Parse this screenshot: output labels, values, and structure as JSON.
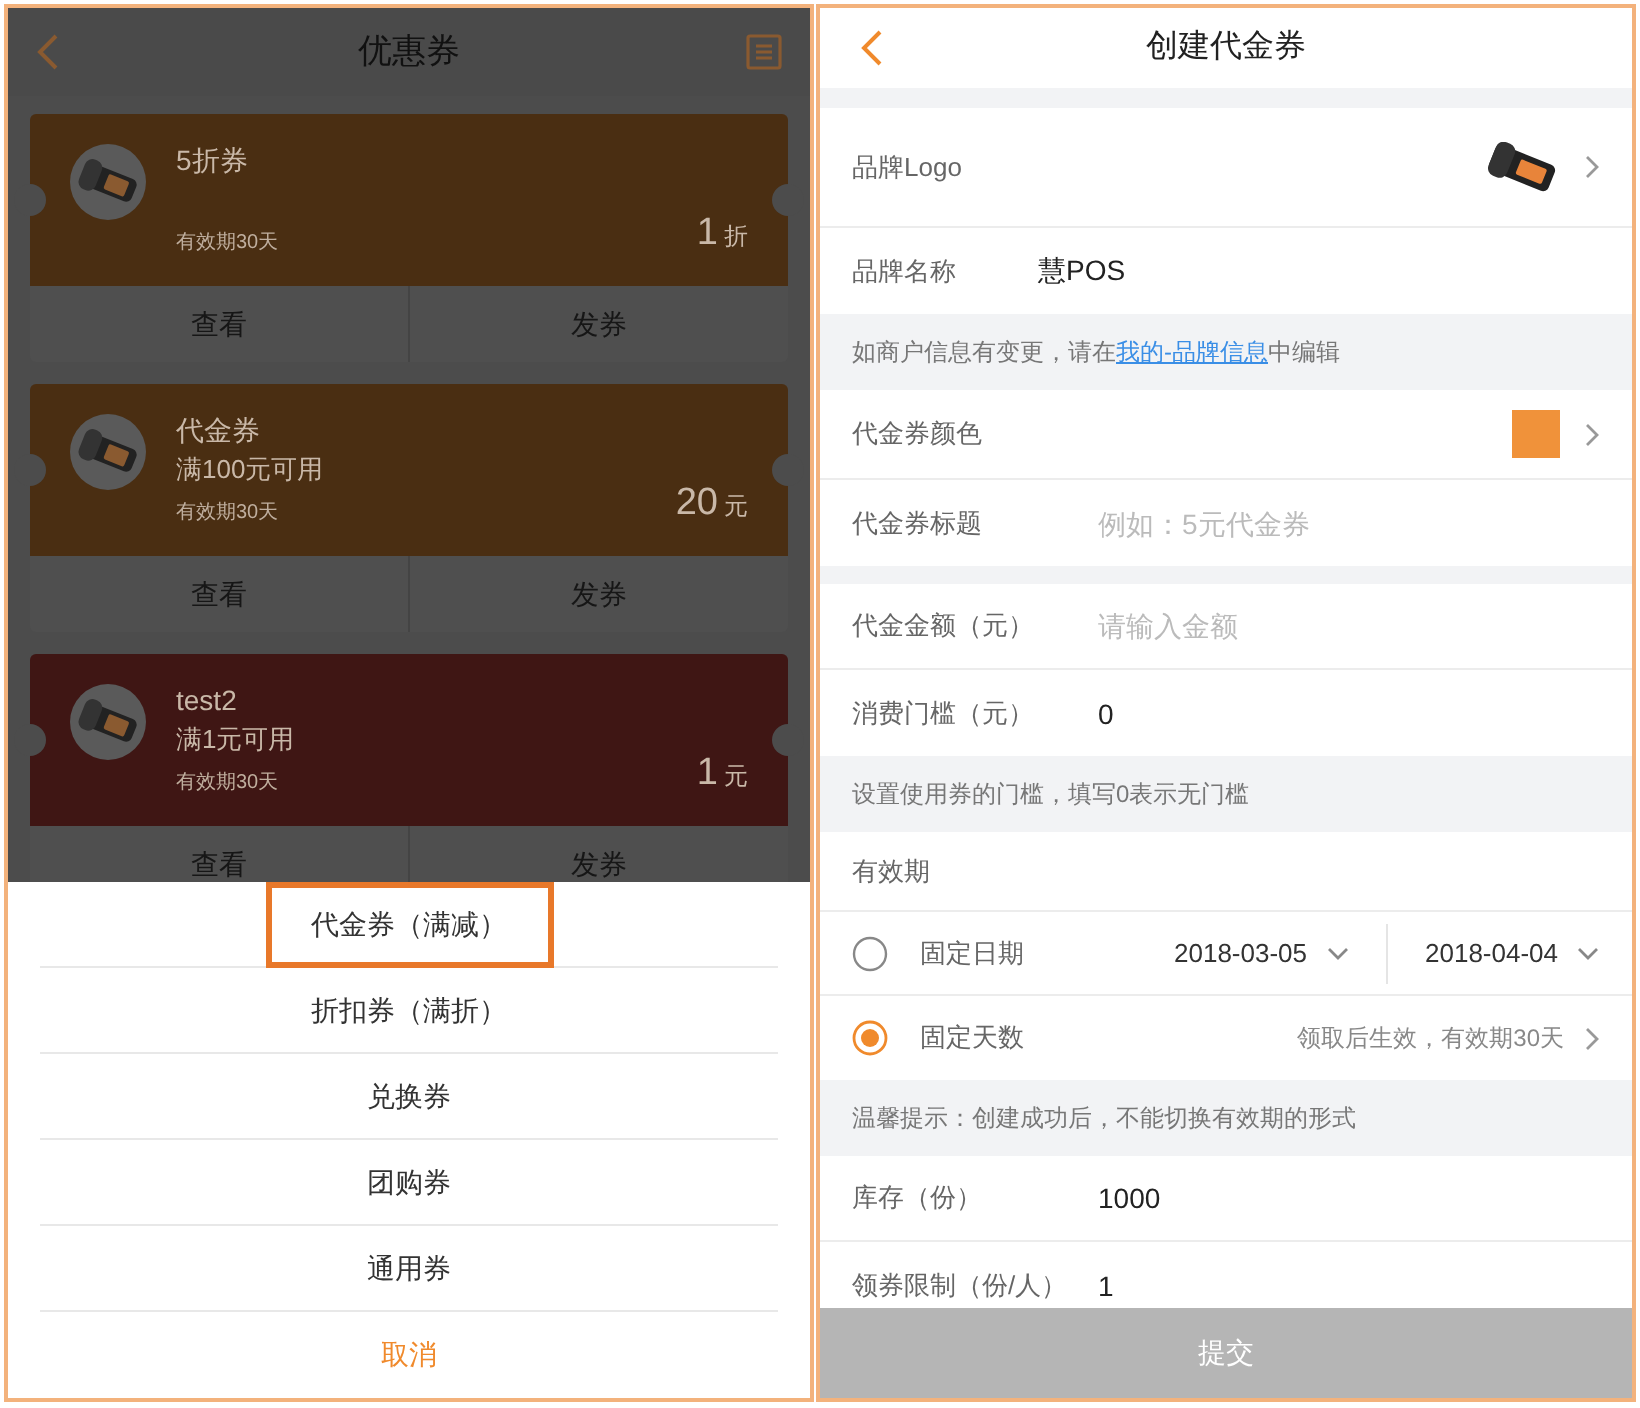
{
  "coupon_list": {
    "title": "优惠券",
    "coupons": [
      {
        "name": "5折券",
        "validity": "有效期30天",
        "amount": "1",
        "unit": "折",
        "color": "#4a2e12",
        "actions": [
          "查看",
          "发券"
        ]
      },
      {
        "name": "代金券",
        "condition": "满100元可用",
        "validity": "有效期30天",
        "amount": "20",
        "unit": "元",
        "color": "#4a2e12",
        "actions": [
          "查看",
          "发券"
        ]
      },
      {
        "name": "test2",
        "condition": "满1元可用",
        "validity": "有效期30天",
        "amount": "1",
        "unit": "元",
        "color": "#3f1614",
        "actions": [
          "查看",
          "发券"
        ]
      }
    ]
  },
  "action_sheet": {
    "options": [
      {
        "label": "代金券（满减）",
        "highlighted": true
      },
      {
        "label": "折扣券（满折）",
        "highlighted": false
      },
      {
        "label": "兑换券",
        "highlighted": false
      },
      {
        "label": "团购券",
        "highlighted": false
      },
      {
        "label": "通用券",
        "highlighted": false
      }
    ],
    "cancel": "取消"
  },
  "form": {
    "title": "创建代金券",
    "sections": [
      {
        "rows": [
          {
            "kind": "logo",
            "label": "品牌Logo"
          },
          {
            "kind": "static",
            "label": "品牌名称",
            "value": "慧POS"
          },
          {
            "kind": "note",
            "text": "如商户信息有变更，请在",
            "link": "我的-品牌信息",
            "text_after": "中编辑"
          },
          {
            "kind": "color",
            "label": "代金券颜色",
            "color": "#f0923a"
          },
          {
            "kind": "input",
            "label": "代金券标题",
            "placeholder": "例如：5元代金券"
          }
        ]
      },
      {
        "rows": [
          {
            "kind": "input",
            "label": "代金金额（元）",
            "placeholder": "请输入金额"
          },
          {
            "kind": "input",
            "label": "消费门槛（元）",
            "value": "0"
          },
          {
            "kind": "note",
            "text": "设置使用券的门槛，填写0表示无门槛"
          },
          {
            "kind": "heading",
            "label": "有效期"
          },
          {
            "kind": "radio",
            "label": "固定日期",
            "selected": false,
            "dates": [
              "2018-03-05",
              "2018-04-04"
            ]
          },
          {
            "kind": "radio",
            "label": "固定天数",
            "selected": true,
            "detail": "领取后生效，有效期30天"
          },
          {
            "kind": "note",
            "text": "温馨提示：创建成功后，不能切换有效期的形式"
          },
          {
            "kind": "input",
            "label": "库存（份）",
            "value": "1000"
          },
          {
            "kind": "input",
            "label": "领券限制（份/人）",
            "value": "1"
          }
        ]
      }
    ],
    "submit": {
      "label": "提交",
      "disabled": true
    }
  }
}
